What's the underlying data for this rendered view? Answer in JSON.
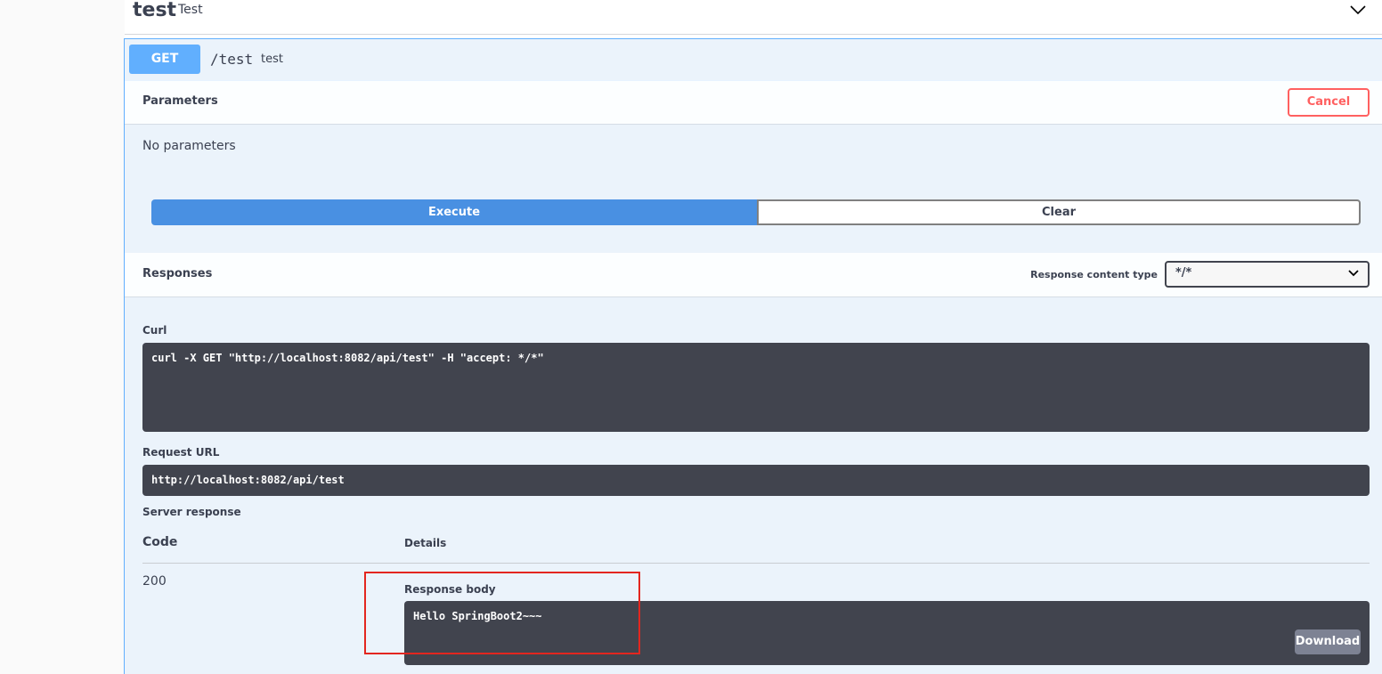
{
  "tag": {
    "name": "test",
    "description": "Test"
  },
  "operation": {
    "method": "GET",
    "path": "/test",
    "description": "test"
  },
  "parameters": {
    "title": "Parameters",
    "cancel_label": "Cancel",
    "empty_text": "No parameters"
  },
  "actions": {
    "execute_label": "Execute",
    "clear_label": "Clear"
  },
  "responses": {
    "title": "Responses",
    "content_type_label": "Response content type",
    "content_type_value": "*/*"
  },
  "curl": {
    "label": "Curl",
    "command": "curl -X GET \"http://localhost:8082/api/test\" -H \"accept: */*\""
  },
  "request_url": {
    "label": "Request URL",
    "value": "http://localhost:8082/api/test"
  },
  "server_response": {
    "label": "Server response",
    "code_header": "Code",
    "details_header": "Details",
    "code": "200",
    "body_label": "Response body",
    "body": "Hello SpringBoot2~~~",
    "download_label": "Download"
  },
  "colors": {
    "get": "#61affe",
    "execute": "#4990e2",
    "cancel": "#ff6060",
    "highlight": "#e3261f"
  }
}
